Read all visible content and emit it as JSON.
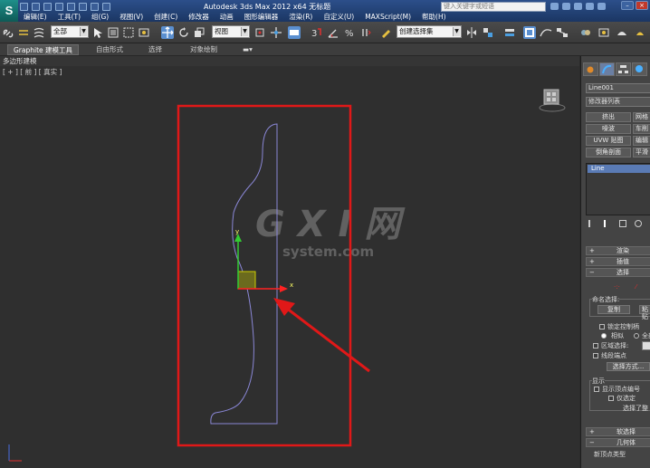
{
  "title_bar": {
    "logo": "S",
    "window_title": "Autodesk 3ds Max  2012 x64      无标题",
    "search_placeholder": "键入关键字或短语"
  },
  "menu": [
    "编辑(E)",
    "工具(T)",
    "组(G)",
    "视图(V)",
    "创建(C)",
    "修改器",
    "动画",
    "图形编辑器",
    "渲染(R)",
    "自定义(U)",
    "MAXScript(M)",
    "帮助(H)"
  ],
  "toolbar": {
    "selection_filter": "全部",
    "reference_coord": "视图",
    "named_selection": "创建选择集"
  },
  "ribbon": {
    "tabs": [
      "Graphite 建模工具",
      "自由形式",
      "选择",
      "对象绘制"
    ],
    "sub_label": "多边形建模"
  },
  "viewport": {
    "label": "[ + ] [ 前 ] [ 真实 ]",
    "gizmo_axis_x": "x",
    "gizmo_axis_y": "y",
    "watermark_main": "G X I 网",
    "watermark_sub": "system.com"
  },
  "command_panel": {
    "object_name": "Line001",
    "modifier_list": "修改器列表",
    "modifier_buttons": [
      "挤出",
      "网格",
      "噪波",
      "车削",
      "UVW 贴图",
      "编辑",
      "倒角剖面",
      "平滑"
    ],
    "stack_item": "Line",
    "rollouts": {
      "render": "渲染",
      "interpolation": "插值",
      "selection": "选择",
      "soft_selection": "软选择",
      "geometry": "几何体"
    },
    "named_selection_group": "命名选择:",
    "copy_button": "复制",
    "paste_button": "粘贴",
    "lock_handles": "锁定控制柄",
    "similar": "相似",
    "all": "全部",
    "area_select": "区域选择:",
    "segment_end": "线段端点",
    "select_by": "选择方式...",
    "display_group": "显示",
    "show_vertex_numbers": "显示顶点编号",
    "selected_only": "仅选定",
    "selected_count": "选择了整",
    "new_vertex_type": "新顶点类型"
  },
  "colors": {
    "annotation_red": "#e01818",
    "spline": "#8a87d6",
    "gizmo_y": "#33cc33",
    "gizmo_x": "#ff2222",
    "gizmo_plane": "#cccc00"
  }
}
